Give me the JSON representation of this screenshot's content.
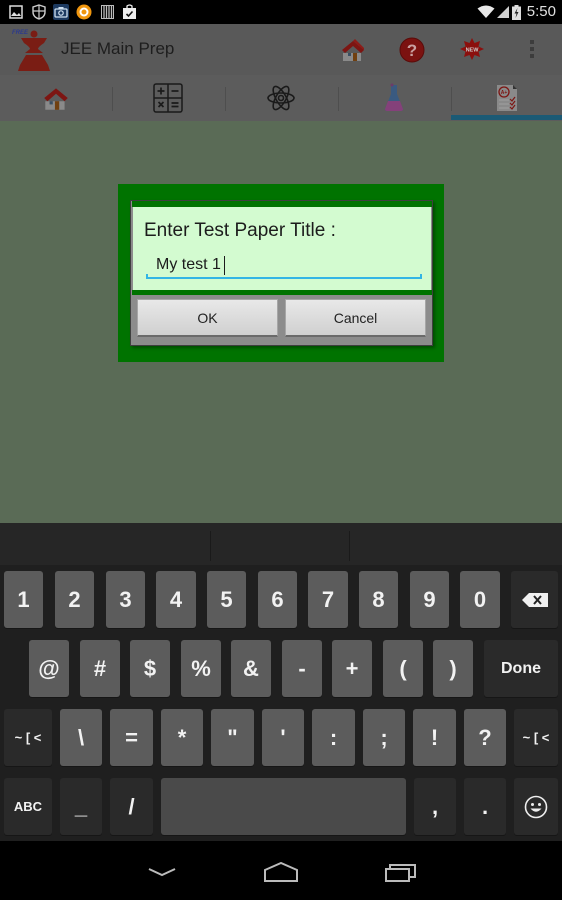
{
  "status_bar": {
    "left_icons": [
      "gallery-icon",
      "shield-icon",
      "camera-icon",
      "orange-app-icon",
      "barcode-icon",
      "shopping-bag-icon"
    ],
    "right_icons": [
      "wifi-icon",
      "signal-icon",
      "battery-charging-icon"
    ],
    "time": "5:50"
  },
  "app_bar": {
    "title": "JEE Main Prep",
    "logo_badge": "FREE",
    "actions": [
      {
        "name": "home",
        "icon": "house-icon"
      },
      {
        "name": "help",
        "icon": "question-icon"
      },
      {
        "name": "new",
        "icon": "new-badge-icon",
        "label": "NEW"
      },
      {
        "name": "overflow",
        "icon": "overflow-menu-icon"
      }
    ]
  },
  "tabs": [
    {
      "name": "home",
      "icon": "house-icon",
      "selected": false
    },
    {
      "name": "maths",
      "icon": "calculator-icon",
      "selected": false
    },
    {
      "name": "physics",
      "icon": "atom-icon",
      "selected": false
    },
    {
      "name": "chemistry",
      "icon": "flask-icon",
      "selected": false
    },
    {
      "name": "test",
      "icon": "test-paper-icon",
      "selected": true
    }
  ],
  "dialog": {
    "label": "Enter Test Paper Title :",
    "input_value": "My test 1",
    "ok_label": "OK",
    "cancel_label": "Cancel"
  },
  "keyboard": {
    "row1": [
      "1",
      "2",
      "3",
      "4",
      "5",
      "6",
      "7",
      "8",
      "9",
      "0"
    ],
    "row2": [
      "@",
      "#",
      "$",
      "%",
      "&",
      "-",
      "+",
      "(",
      ")"
    ],
    "done_label": "Done",
    "row3": [
      "\\",
      "=",
      "*",
      "\"",
      "'",
      ":",
      ";",
      "!",
      "?"
    ],
    "more_symbols_label": "~ [ <",
    "abc_label": "ABC",
    "row4_left": [
      "_",
      "/"
    ],
    "row4_right": [
      ",",
      "."
    ]
  },
  "colors": {
    "dialog_green": "#007300",
    "dialog_body": "#d3fbd0",
    "input_underline": "#33b5e5",
    "tab_indicator": "#1b5a75"
  }
}
